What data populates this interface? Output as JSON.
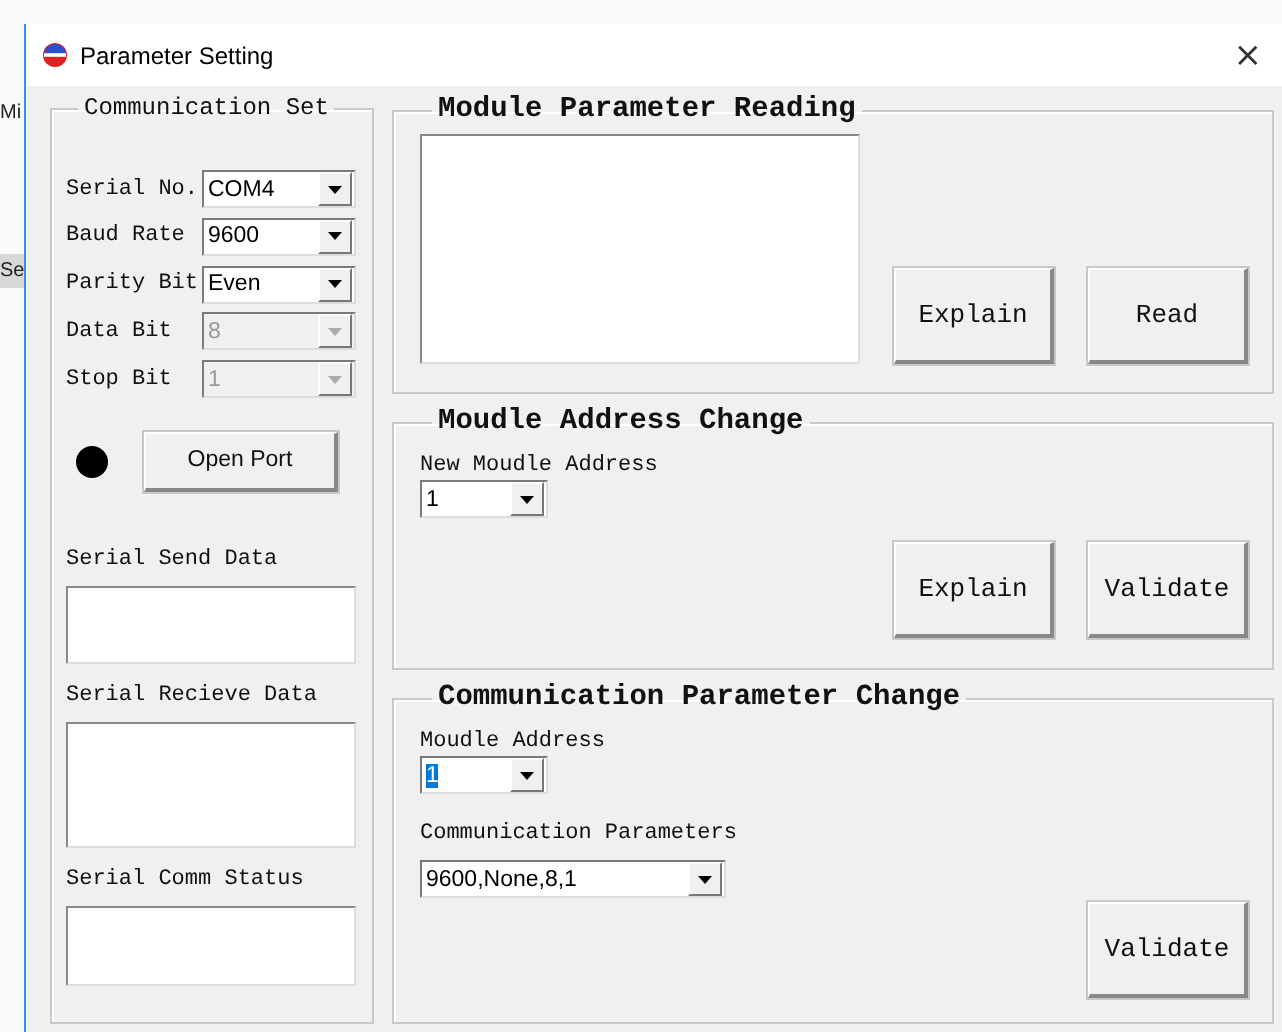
{
  "background": {
    "texts": [
      "Mi",
      "Se"
    ]
  },
  "window": {
    "title": "Parameter Setting",
    "close": "×"
  },
  "communication_set": {
    "title": "Communication Set",
    "fields": [
      {
        "label": "Serial No.",
        "value": "COM4",
        "disabled": false
      },
      {
        "label": "Baud Rate",
        "value": "9600",
        "disabled": false
      },
      {
        "label": "Parity Bit",
        "value": "Even",
        "disabled": false
      },
      {
        "label": "Data Bit",
        "value": "8",
        "disabled": true
      },
      {
        "label": "Stop Bit",
        "value": "1",
        "disabled": true
      }
    ],
    "port_open": false,
    "open_port_button": "Open Port",
    "boxes": [
      {
        "label": "Serial Send Data"
      },
      {
        "label": "Serial Recieve Data"
      },
      {
        "label": "Serial Comm Status"
      }
    ]
  },
  "module_parameter_reading": {
    "title": "Module Parameter Reading",
    "buttons": [
      "Explain",
      "Read"
    ]
  },
  "module_address_change": {
    "title": "Moudle Address Change",
    "label": "New Moudle Address",
    "value": "1",
    "buttons": [
      "Explain",
      "Validate"
    ]
  },
  "communication_parameter_change": {
    "title": "Communication Parameter Change",
    "address": {
      "label": "Moudle Address",
      "value": "1",
      "focused": true
    },
    "parameters": {
      "label": "Communication Parameters",
      "value": "9600,None,8,1",
      "focused": false
    },
    "button": "Validate"
  }
}
